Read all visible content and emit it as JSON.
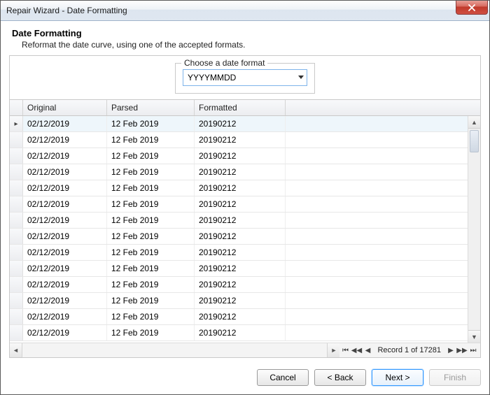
{
  "window": {
    "title": "Repair Wizard - Date Formatting"
  },
  "header": {
    "title": "Date Formatting",
    "subtitle": "Reformat the date curve, using one of the accepted formats."
  },
  "format": {
    "legend": "Choose a date format",
    "selected": "YYYYMMDD"
  },
  "grid": {
    "columns": {
      "original": "Original",
      "parsed": "Parsed",
      "formatted": "Formatted"
    },
    "rows": [
      {
        "original": "02/12/2019",
        "parsed": "12 Feb 2019",
        "formatted": "20190212"
      },
      {
        "original": "02/12/2019",
        "parsed": "12 Feb 2019",
        "formatted": "20190212"
      },
      {
        "original": "02/12/2019",
        "parsed": "12 Feb 2019",
        "formatted": "20190212"
      },
      {
        "original": "02/12/2019",
        "parsed": "12 Feb 2019",
        "formatted": "20190212"
      },
      {
        "original": "02/12/2019",
        "parsed": "12 Feb 2019",
        "formatted": "20190212"
      },
      {
        "original": "02/12/2019",
        "parsed": "12 Feb 2019",
        "formatted": "20190212"
      },
      {
        "original": "02/12/2019",
        "parsed": "12 Feb 2019",
        "formatted": "20190212"
      },
      {
        "original": "02/12/2019",
        "parsed": "12 Feb 2019",
        "formatted": "20190212"
      },
      {
        "original": "02/12/2019",
        "parsed": "12 Feb 2019",
        "formatted": "20190212"
      },
      {
        "original": "02/12/2019",
        "parsed": "12 Feb 2019",
        "formatted": "20190212"
      },
      {
        "original": "02/12/2019",
        "parsed": "12 Feb 2019",
        "formatted": "20190212"
      },
      {
        "original": "02/12/2019",
        "parsed": "12 Feb 2019",
        "formatted": "20190212"
      },
      {
        "original": "02/12/2019",
        "parsed": "12 Feb 2019",
        "formatted": "20190212"
      },
      {
        "original": "02/12/2019",
        "parsed": "12 Feb 2019",
        "formatted": "20190212"
      }
    ],
    "navigator": "Record 1 of 17281"
  },
  "footer": {
    "cancel": "Cancel",
    "back": "<  Back",
    "next": "Next  >",
    "finish": "Finish"
  }
}
